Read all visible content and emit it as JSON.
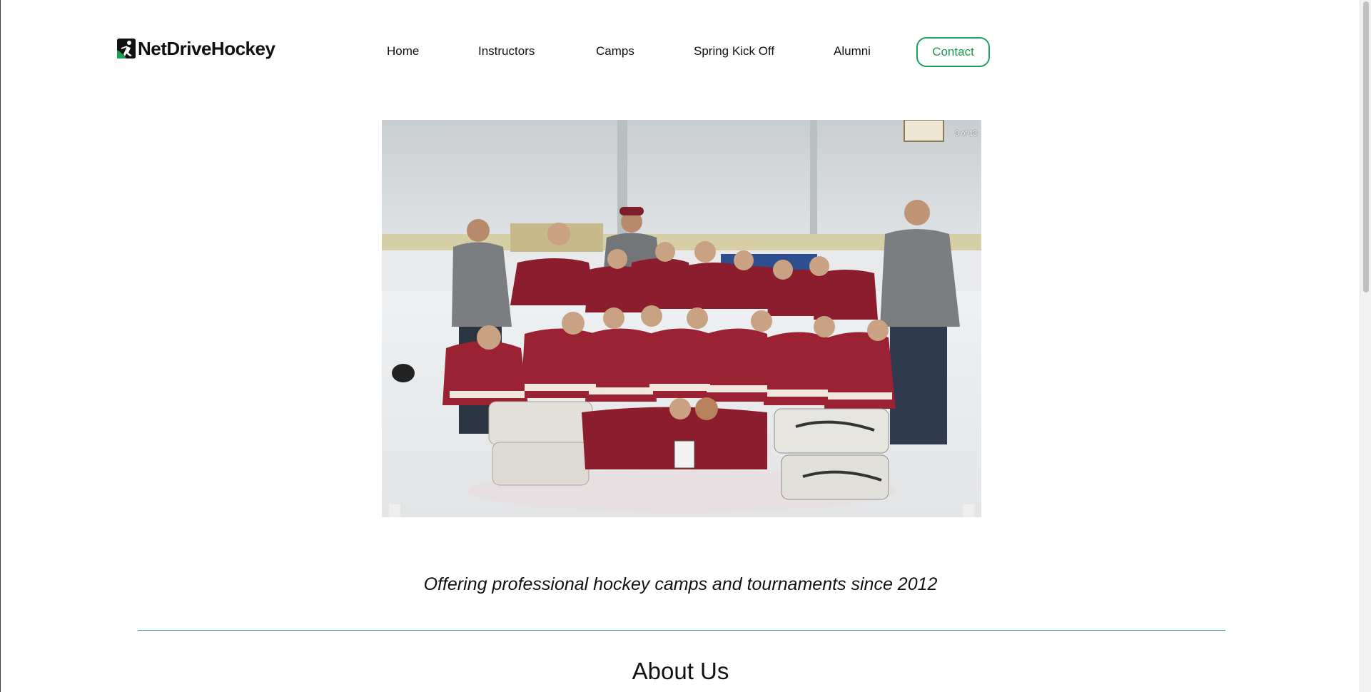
{
  "header": {
    "logo_text": "NetDriveHockey",
    "nav": [
      {
        "label": "Home"
      },
      {
        "label": "Instructors"
      },
      {
        "label": "Camps"
      },
      {
        "label": "Spring Kick Off"
      },
      {
        "label": "Alumni"
      }
    ],
    "contact_label": "Contact"
  },
  "slideshow": {
    "counter": "3 of 13",
    "current": 3,
    "total": 13,
    "image_alt": "Youth hockey team photo with medals on the ice"
  },
  "tagline": "Offering professional hockey camps and tournaments since 2012",
  "about": {
    "heading": "About Us"
  },
  "colors": {
    "accent_green": "#1fa15a",
    "divider_green": "#3aa07a",
    "jersey_red": "#8b1d2c"
  },
  "icons": {
    "logo": "hockey-player-icon",
    "prev": "chevron-left-icon",
    "next": "chevron-right-icon"
  }
}
